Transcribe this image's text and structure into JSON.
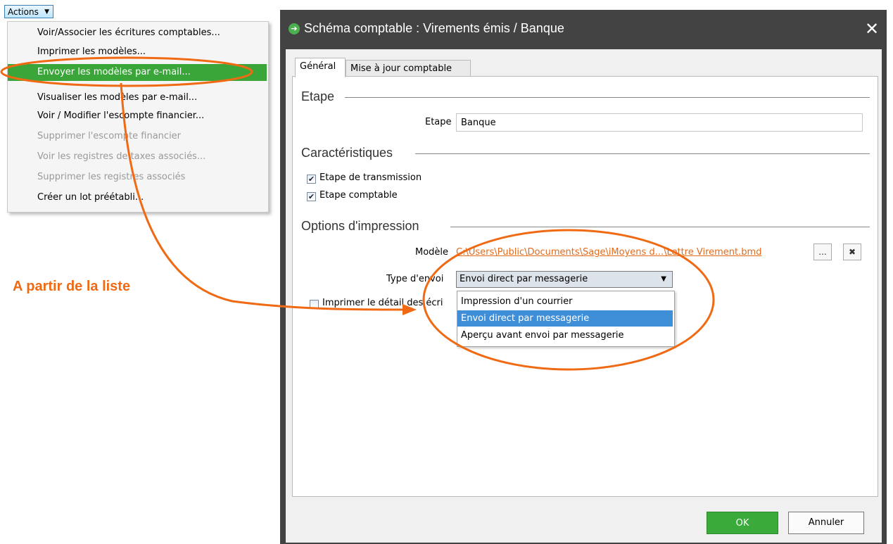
{
  "actions_menu": {
    "button_label": "Actions",
    "items": [
      {
        "label": "Voir/Associer les écritures comptables...",
        "enabled": true,
        "highlighted": false
      },
      {
        "label": "Imprimer les modèles...",
        "enabled": true,
        "highlighted": false
      },
      {
        "label": "Envoyer les modèles par e-mail...",
        "enabled": true,
        "highlighted": true
      },
      {
        "label": "Visualiser les modèles par e-mail...",
        "enabled": true,
        "highlighted": false
      },
      {
        "label": "Voir / Modifier l'escompte financier...",
        "enabled": true,
        "highlighted": false
      },
      {
        "label": "Supprimer l'escompte financier",
        "enabled": false,
        "highlighted": false
      },
      {
        "label": "Voir les registres de taxes associés...",
        "enabled": false,
        "highlighted": false
      },
      {
        "label": "Supprimer les registres associés",
        "enabled": false,
        "highlighted": false
      },
      {
        "label": "Créer un lot préétabli...",
        "enabled": true,
        "highlighted": false
      }
    ]
  },
  "annotation": {
    "text": "A partir de la liste",
    "color": "#f06a14"
  },
  "dialog": {
    "title": "Schéma comptable : Virements émis / Banque",
    "tabs": [
      {
        "label": "Général",
        "active": true
      },
      {
        "label": "Mise à jour comptable",
        "active": false
      }
    ],
    "etape_group": {
      "title": "Etape",
      "field_label": "Etape",
      "field_value": "Banque"
    },
    "caracteristiques_group": {
      "title": "Caractéristiques",
      "checkboxes": [
        {
          "label": "Etape de transmission",
          "checked": true
        },
        {
          "label": "Etape comptable",
          "checked": true
        }
      ]
    },
    "options_group": {
      "title": "Options d'impression",
      "modele_label": "Modèle",
      "modele_path": "C:\\Users\\Public\\Documents\\Sage\\iMoyens d...\\Lettre Virement.bmd",
      "browse_button": "...",
      "clear_button": "✖",
      "type_label": "Type d'envoi",
      "type_value": "Envoi direct par messagerie",
      "type_options": [
        {
          "label": "Impression d'un courrier",
          "selected": false
        },
        {
          "label": "Envoi direct par messagerie",
          "selected": true
        },
        {
          "label": "Aperçu avant envoi par messagerie",
          "selected": false
        }
      ],
      "detail_checkbox": {
        "label": "Imprimer le détail des écri",
        "checked": false
      }
    },
    "ok_button": "OK",
    "cancel_button": "Annuler"
  },
  "colors": {
    "highlight_green": "#3aa63a",
    "accent_orange": "#f06a14",
    "selection_blue": "#3e8fd8"
  }
}
